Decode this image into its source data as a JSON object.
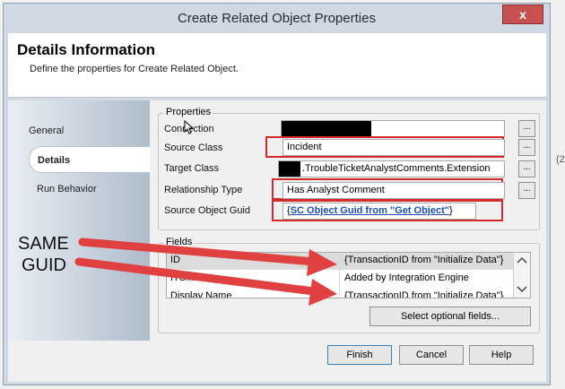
{
  "window": {
    "title": "Create Related Object Properties",
    "close_glyph": "x"
  },
  "header": {
    "title": "Details Information",
    "subtitle": "Define the properties for Create Related Object."
  },
  "nav": {
    "items": [
      "General",
      "Details",
      "Run Behavior"
    ],
    "selected": "Details"
  },
  "properties": {
    "group_label": "Properties",
    "connection_label": "Connection",
    "source_class_label": "Source Class",
    "source_class_value": "Incident",
    "target_class_label": "Target Class",
    "target_class_value": ".TroubleTicketAnalystComments.Extension",
    "relationship_type_label": "Relationship Type",
    "relationship_type_value": "Has Analyst Comment",
    "source_guid_label": "Source Object Guid",
    "source_guid_open": "{",
    "source_guid_link": "SC Object Guid from \"Get Object\"",
    "source_guid_close": "}",
    "browse_label": "..."
  },
  "fields": {
    "group_label": "Fields",
    "rows": [
      {
        "key": "ID",
        "value": "{TransactionID from \"Initialize Data\"}"
      },
      {
        "key": "ITSMNotes",
        "value": "Added by Integration Engine"
      },
      {
        "key": "Display Name",
        "value": "{TransactionID from \"Initialize Data\"}"
      }
    ],
    "select_optional_label": "Select optional fields..."
  },
  "footer": {
    "finish": "Finish",
    "cancel": "Cancel",
    "help": "Help"
  },
  "annotation": {
    "line1": "SAME",
    "line2": "GUID"
  },
  "edge_fragment": "(2",
  "colors": {
    "accent_red": "#d42a2a",
    "link_blue": "#1a4fb3",
    "arrow_red": "#e04040"
  }
}
